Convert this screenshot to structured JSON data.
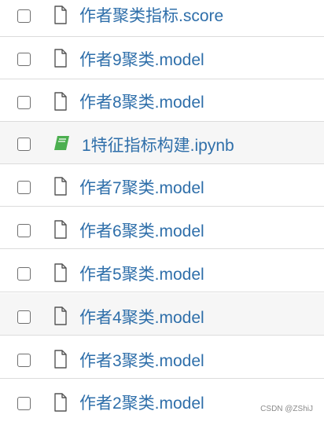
{
  "files": [
    {
      "name": "作者聚类指标.score",
      "icon": "file-icon"
    },
    {
      "name": "作者9聚类.model",
      "icon": "file-icon"
    },
    {
      "name": "作者8聚类.model",
      "icon": "file-icon"
    },
    {
      "name": "1特征指标构建.ipynb",
      "icon": "notebook-icon"
    },
    {
      "name": "作者7聚类.model",
      "icon": "file-icon"
    },
    {
      "name": "作者6聚类.model",
      "icon": "file-icon"
    },
    {
      "name": "作者5聚类.model",
      "icon": "file-icon"
    },
    {
      "name": "作者4聚类.model",
      "icon": "file-icon"
    },
    {
      "name": "作者3聚类.model",
      "icon": "file-icon"
    },
    {
      "name": "作者2聚类.model",
      "icon": "file-icon"
    }
  ],
  "watermark": "CSDN @ZShiJ",
  "colors": {
    "link": "#2f6faa",
    "notebook_icon": "#4caf50",
    "row_alt_bg": "#f6f6f6"
  }
}
